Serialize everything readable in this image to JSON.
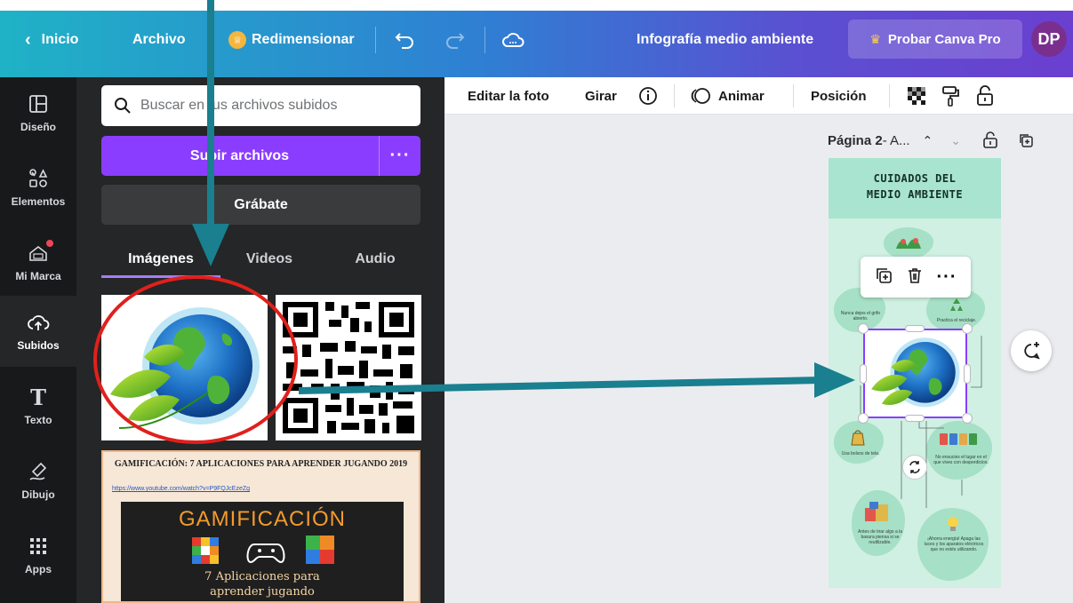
{
  "topbar": {
    "home_label": "Inicio",
    "file_label": "Archivo",
    "resize_label": "Redimensionar",
    "design_title": "Infografía medio ambiente",
    "pro_label": "Probar Canva Pro",
    "avatar_initials": "DP"
  },
  "rail": {
    "items": [
      {
        "label": "Diseño",
        "icon": "layout-icon"
      },
      {
        "label": "Elementos",
        "icon": "shapes-icon"
      },
      {
        "label": "Mi Marca",
        "icon": "brand-icon"
      },
      {
        "label": "Subidos",
        "icon": "cloud-upload-icon"
      },
      {
        "label": "Texto",
        "icon": "text-icon"
      },
      {
        "label": "Dibujo",
        "icon": "draw-icon"
      },
      {
        "label": "Apps",
        "icon": "apps-grid-icon"
      }
    ]
  },
  "panel": {
    "search_placeholder": "Buscar en tus archivos subidos",
    "upload_label": "Subir archivos",
    "more_label": "···",
    "record_label": "Grábate",
    "tabs": [
      {
        "label": "Imágenes",
        "active": true
      },
      {
        "label": "Videos",
        "active": false
      },
      {
        "label": "Audio",
        "active": false
      }
    ],
    "doc_thumb": {
      "title": "GAMIFICACIÓN: 7 APLICACIONES PARA APRENDER JUGANDO 2019",
      "link": "https://www.youtube.com/watch?v=P9FQJcEzeZg",
      "slide_heading": "GAMIFICACIÓN",
      "slide_line1": "7 Aplicaciones para",
      "slide_line2": "aprender jugando"
    }
  },
  "toolbar": {
    "edit_photo": "Editar la foto",
    "rotate": "Girar",
    "animate": "Animar",
    "position": "Posición"
  },
  "page_bar": {
    "page_label": "Página 2",
    "page_suffix": " - A..."
  },
  "infographic": {
    "title_line1": "CUIDADOS DEL",
    "title_line2": "MEDIO AMBIENTE",
    "tip1": "Nunca dejes el grifo abierto.",
    "tip2": "Practica el reciclaje.",
    "tip3": "Usa bolsos de tela.",
    "tip4": "No ensucies el lugar en el que vives con desperdicios.",
    "tip5": "Antes de tirar algo a la basura piensa si se reutilizable.",
    "tip6": "¡Ahorra energía! Apaga las luces y los aparatos eléctricos que no estés utilizando."
  },
  "colors": {
    "accent_purple": "#8b3dff",
    "annotation_teal": "#1a7f8f",
    "annotation_red": "#e0201c"
  }
}
